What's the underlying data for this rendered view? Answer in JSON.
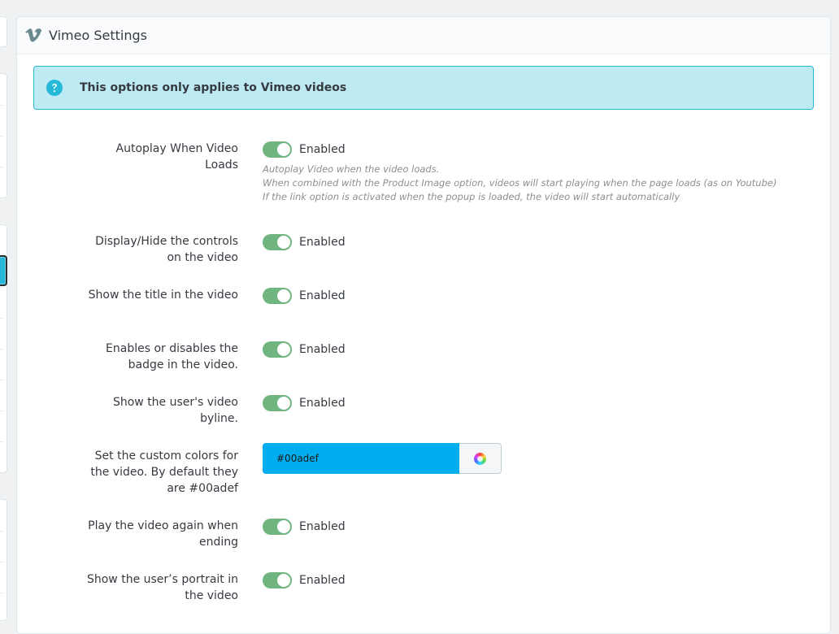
{
  "panel": {
    "title": "Vimeo Settings",
    "icon": "vimeo-icon"
  },
  "alert": {
    "icon": "question-circle-icon",
    "text": "This options only applies to Vimeo videos"
  },
  "settings": [
    {
      "label": "Autoplay When Video Loads",
      "state": "Enabled",
      "help": [
        "Autoplay Video when the video loads.",
        "When combined with the Product Image option, videos will start playing when the page loads (as on Youtube)",
        "If the link option is activated when the popup is loaded, the video will start automatically"
      ]
    },
    {
      "label": "Display/Hide the controls on the video",
      "state": "Enabled"
    },
    {
      "label": "Show the title in the video",
      "state": "Enabled"
    },
    {
      "label": "Enables or disables the badge in the video.",
      "state": "Enabled"
    },
    {
      "label": "Show the user's video byline.",
      "state": "Enabled"
    },
    {
      "label": "Set the custom colors for the video. By default they are #00adef",
      "color_value": "#00adef"
    },
    {
      "label": "Play the video again when ending",
      "state": "Enabled"
    },
    {
      "label": "Show the user’s portrait in the video",
      "state": "Enabled"
    }
  ],
  "colors": {
    "switch_on": "#70b580",
    "accent": "#25b9d7",
    "picker": "#00adef"
  }
}
